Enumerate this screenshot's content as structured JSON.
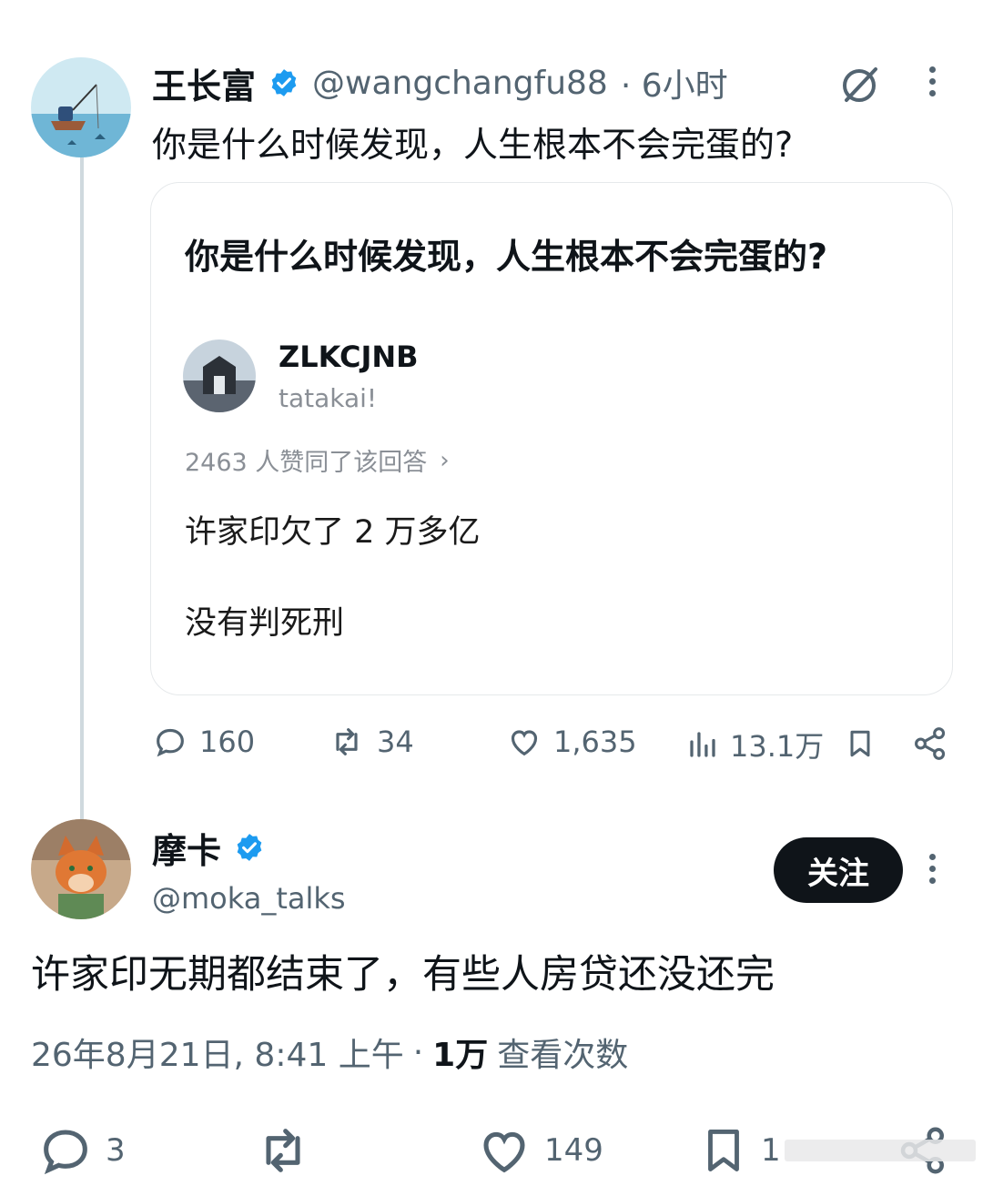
{
  "original_post": {
    "author_name": "王长富",
    "handle": "@wangchangfu88",
    "time": "· 6小时",
    "text": "你是什么时候发现，人生根本不会完蛋的?",
    "quote_card": {
      "title": "你是什么时候发现，人生根本不会完蛋的?",
      "answerer_name": "ZLKCJNB",
      "answerer_bio": "tatakai!",
      "agree_text": "2463 人赞同了该回答",
      "answer_line1": "许家印欠了 2 万多亿",
      "answer_line2": "没有判死刑"
    },
    "stats": {
      "replies": "160",
      "reposts": "34",
      "likes": "1,635",
      "views": "13.1万"
    }
  },
  "reply_post": {
    "author_name": "摩卡",
    "handle": "@moka_talks",
    "follow_label": "关注",
    "text": "许家印无期都结束了，有些人房贷还没还完",
    "timestamp": "26年8月21日, 8:41 上午",
    "view_count": "1万",
    "view_label": "查看次数",
    "stats": {
      "replies": "3",
      "likes": "149",
      "bookmarks": "1"
    }
  },
  "colors": {
    "verified_blue": "#1d9bf0",
    "muted_text": "#536471",
    "primary_text": "#0f1419",
    "thread_line": "#cfd9de"
  },
  "icons": [
    "grok-icon",
    "more-icon",
    "reply-icon",
    "repost-icon",
    "like-icon",
    "views-icon",
    "bookmark-icon",
    "share-icon",
    "verified-badge-icon"
  ]
}
